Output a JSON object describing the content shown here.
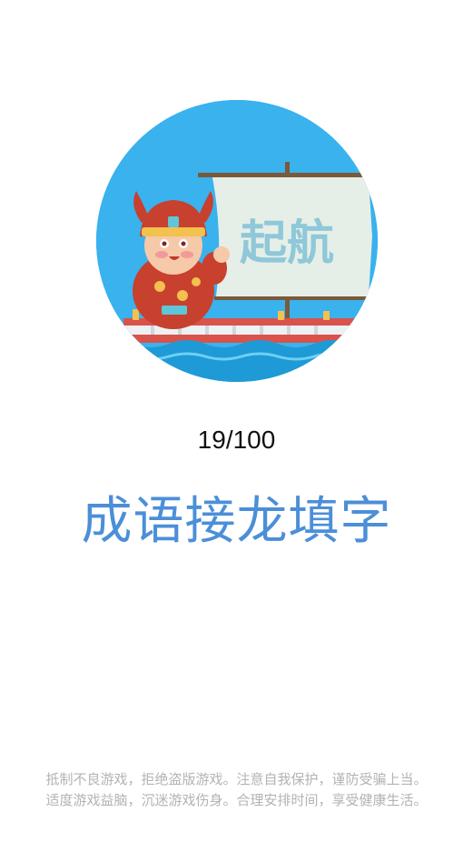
{
  "logo": {
    "sail_text": "起航",
    "colors": {
      "sky": "#39b2ee",
      "sail": "#e6eee8",
      "sail_text": "#8fc8d8",
      "boat": "#d9534a",
      "water": "#1e9bd6",
      "character_robe": "#c8402e",
      "character_gold": "#f2c14e"
    }
  },
  "progress": {
    "text": "19/100"
  },
  "app": {
    "title": "成语接龙填字",
    "title_color": "#4b8fd8"
  },
  "notice": {
    "line1": "抵制不良游戏，拒绝盗版游戏。注意自我保护，谨防受骗上当。",
    "line2": "适度游戏益脑，沉迷游戏伤身。合理安排时间，享受健康生活。"
  }
}
